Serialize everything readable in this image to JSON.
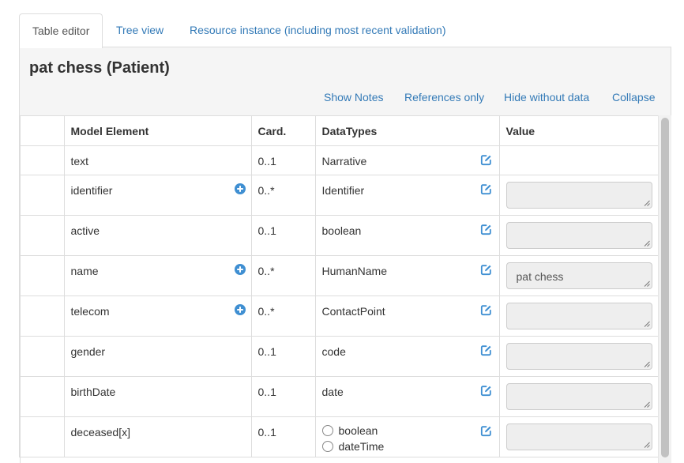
{
  "tabs": [
    {
      "label": "Table editor",
      "active": true
    },
    {
      "label": "Tree view",
      "active": false
    },
    {
      "label": "Resource instance (including most recent validation)",
      "active": false
    }
  ],
  "resource_title": "pat chess (Patient)",
  "actions": {
    "show_notes": "Show Notes",
    "references_only": "References only",
    "hide_without_data": "Hide without data",
    "collapse": "Collapse"
  },
  "table": {
    "headers": {
      "model_element": "Model Element",
      "card": "Card.",
      "datatypes": "DataTypes",
      "value": "Value"
    },
    "rows": [
      {
        "element": "text",
        "card": "0..1",
        "datatype": "Narrative",
        "value": ""
      },
      {
        "element": "identifier",
        "card": "0..*",
        "datatype": "Identifier",
        "value": ""
      },
      {
        "element": "active",
        "card": "0..1",
        "datatype": "boolean",
        "value": ""
      },
      {
        "element": "name",
        "card": "0..*",
        "datatype": "HumanName",
        "value": "pat chess"
      },
      {
        "element": "telecom",
        "card": "0..*",
        "datatype": "ContactPoint",
        "value": ""
      },
      {
        "element": "gender",
        "card": "0..1",
        "datatype": "code",
        "value": ""
      },
      {
        "element": "birthDate",
        "card": "0..1",
        "datatype": "date",
        "value": ""
      },
      {
        "element": "deceased[x]",
        "card": "0..1",
        "datatype_options": [
          "boolean",
          "dateTime"
        ],
        "value": ""
      }
    ]
  },
  "icons": {
    "plus": "plus-circle-icon",
    "edit": "edit-icon"
  },
  "colors": {
    "link": "#337ab7",
    "icon": "#3f8fd2",
    "panel_bg": "#f5f5f5",
    "border": "#dddddd"
  }
}
